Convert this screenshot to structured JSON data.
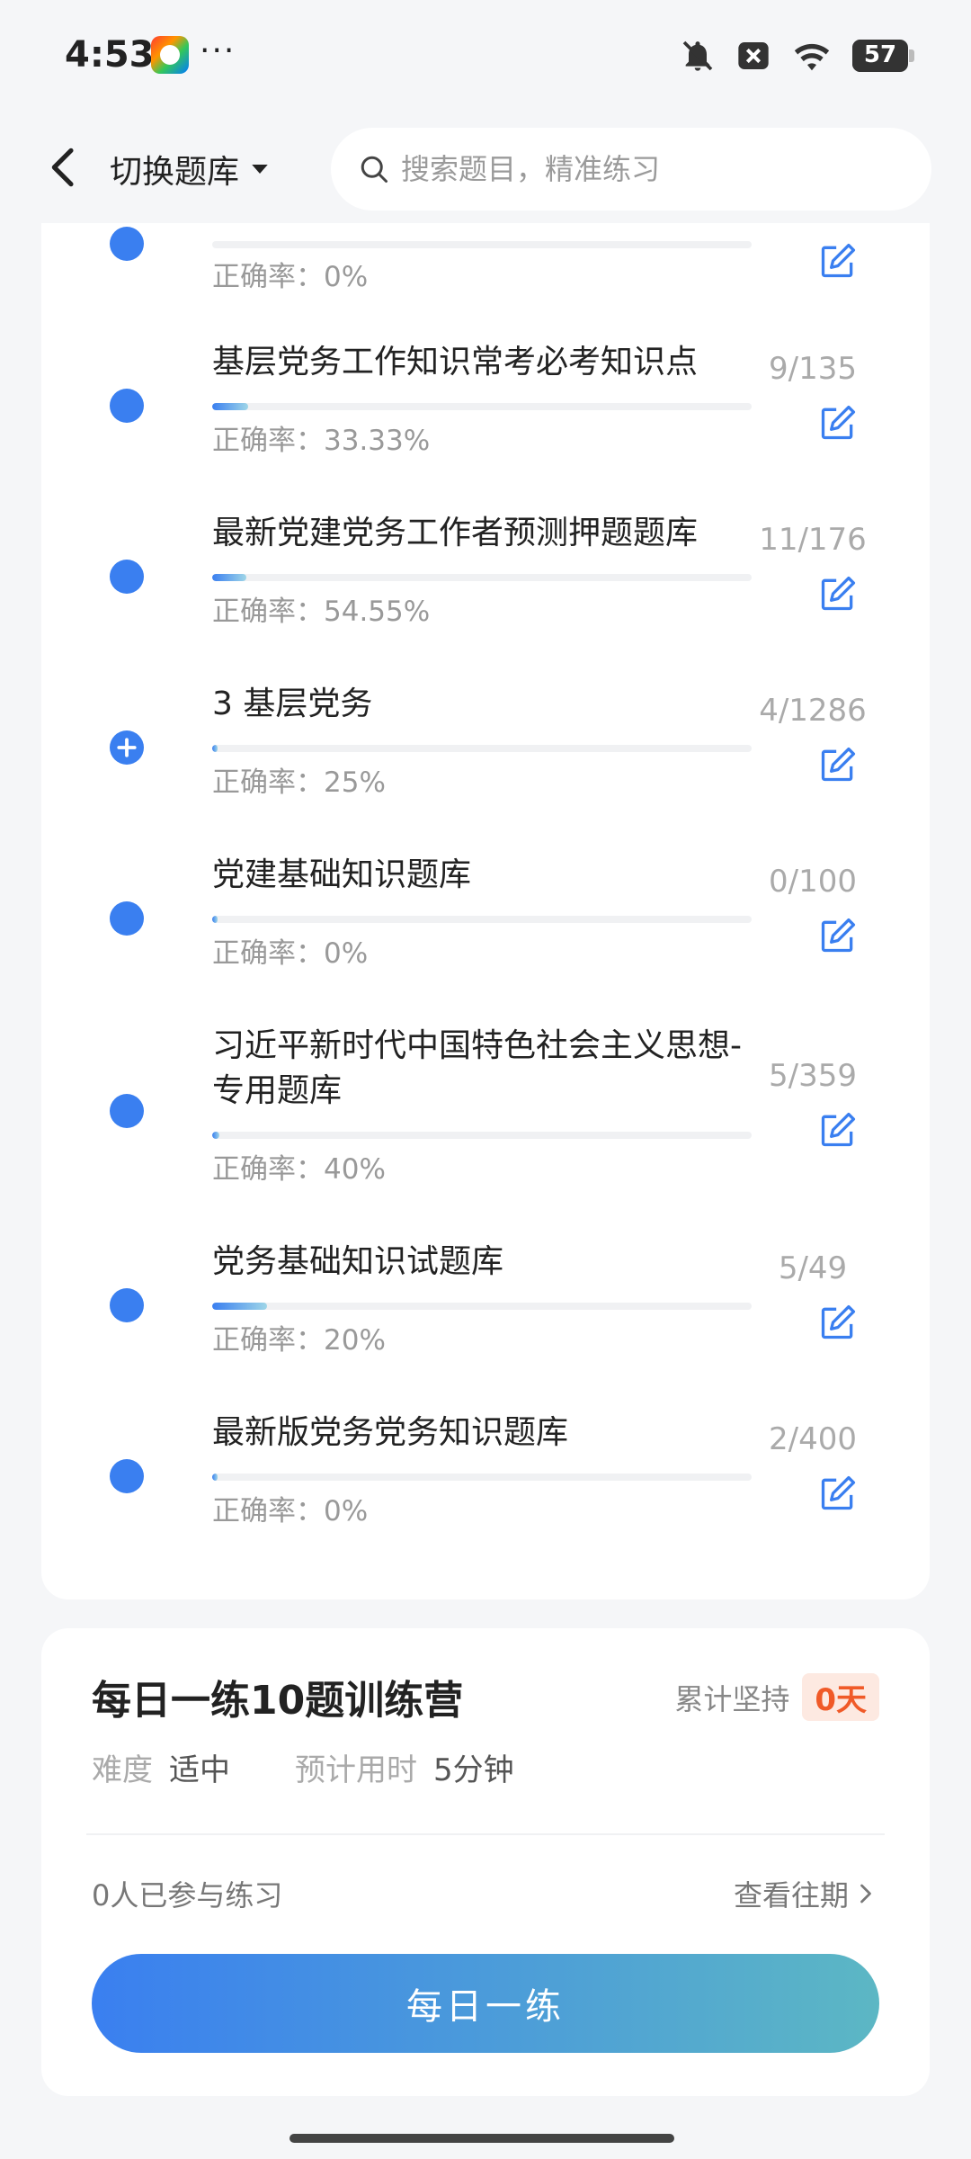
{
  "status_bar": {
    "time": "4:53",
    "more": "···",
    "battery": "57",
    "icons": [
      "app-notification-icon",
      "bell-off-icon",
      "close-box-icon",
      "wifi-icon",
      "battery-icon"
    ]
  },
  "header": {
    "switch_label": "切换题库",
    "search_placeholder": "搜索题目，精准练习"
  },
  "banks": [
    {
      "title": "",
      "count": "",
      "rate": "正确率：0%",
      "progress": 0,
      "marker": "dot"
    },
    {
      "title": "基层党务工作知识常考必考知识点",
      "count": "9/135",
      "rate": "正确率：33.33%",
      "progress": 0.067,
      "marker": "dot"
    },
    {
      "title": "最新党建党务工作者预测押题题库",
      "count": "11/176",
      "rate": "正确率：54.55%",
      "progress": 0.0625,
      "marker": "dot"
    },
    {
      "title": "3 基层党务",
      "count": "4/1286",
      "rate": "正确率：25%",
      "progress": 0.003,
      "marker": "plus"
    },
    {
      "title": "党建基础知识题库",
      "count": "0/100",
      "rate": "正确率：0%",
      "progress": 0,
      "marker": "dot"
    },
    {
      "title": "习近平新时代中国特色社会主义思想-专用题库",
      "count": "5/359",
      "rate": "正确率：40%",
      "progress": 0.014,
      "marker": "dot"
    },
    {
      "title": "党务基础知识试题库",
      "count": "5/49",
      "rate": "正确率：20%",
      "progress": 0.102,
      "marker": "dot"
    },
    {
      "title": "最新版党务党务知识题库",
      "count": "2/400",
      "rate": "正确率：0%",
      "progress": 0.005,
      "marker": "dot"
    }
  ],
  "training": {
    "title": "每日一练10题训练营",
    "streak_label": "累计坚持",
    "streak_value": "0天",
    "difficulty_label": "难度",
    "difficulty_value": "适中",
    "time_label": "预计用时",
    "time_value": "5分钟",
    "participants": "0人已参与练习",
    "history_link": "查看往期",
    "button_label": "每日一练"
  },
  "colors": {
    "accent": "#3a7ff0",
    "accent_end": "#5cb7c4",
    "streak": "#f05a28",
    "muted": "#999999"
  }
}
